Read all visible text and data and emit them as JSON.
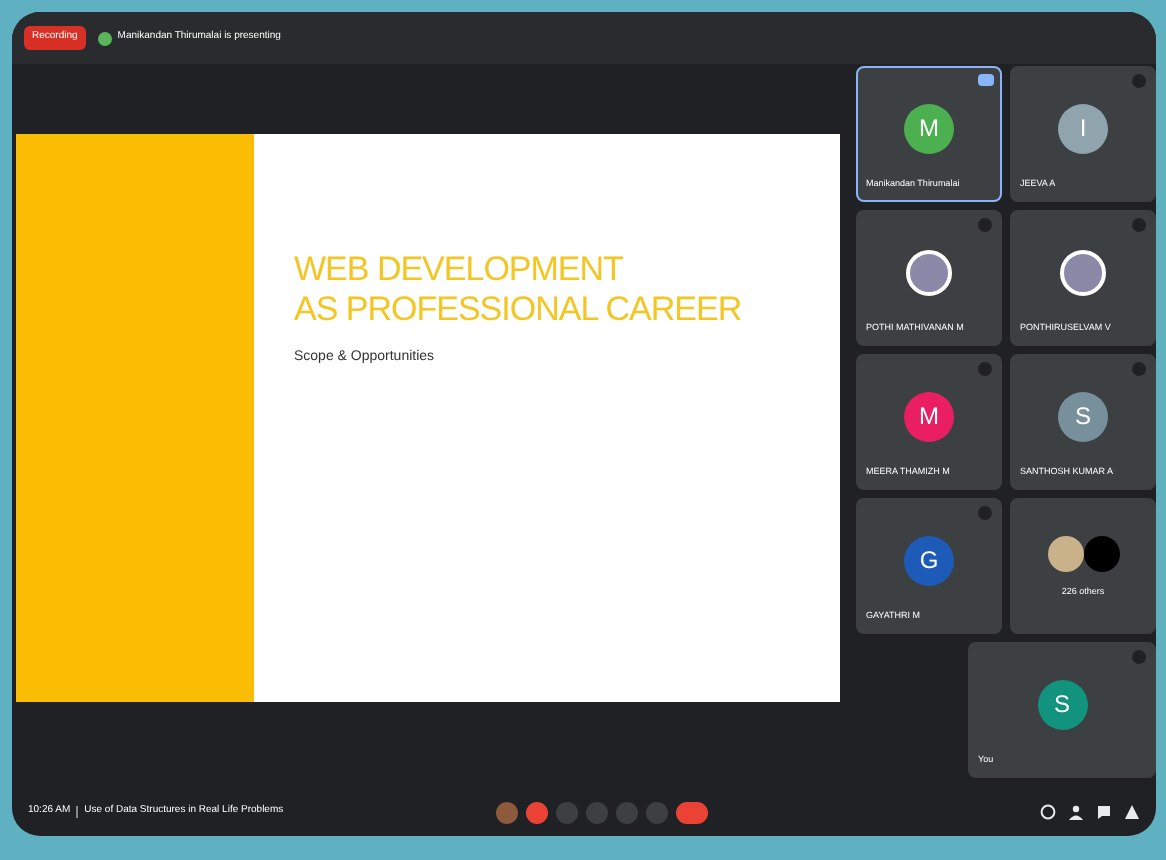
{
  "top_bar": {
    "recording": "Recording",
    "presenter": "Manikandan Thirumalai is presenting"
  },
  "slide": {
    "title_lines": [
      "WEB DEVELOPMENT",
      "AS PROFESSIONAL CAREER"
    ],
    "subtitle": "Scope & Opportunities"
  },
  "participants": [
    {
      "name": "Manikandan Thirumalai",
      "kind": "letter",
      "initial": "M",
      "color": "#4caf50",
      "speaking": true
    },
    {
      "name": "JEEVA A",
      "kind": "letter",
      "initial": "I",
      "color": "#90a4ae",
      "speaking": false
    },
    {
      "name": "POTHI MATHIVANAN M",
      "kind": "photo",
      "speaking": false
    },
    {
      "name": "PONTHIRUSELVAM V",
      "kind": "photo",
      "speaking": false
    },
    {
      "name": "MEERA THAMIZH M",
      "kind": "letter",
      "initial": "M",
      "color": "#e91e63",
      "speaking": false
    },
    {
      "name": "SANTHOSH KUMAR A",
      "kind": "letter",
      "initial": "S",
      "color": "#78909c",
      "speaking": false
    },
    {
      "name": "GAYATHRI M",
      "kind": "letter",
      "initial": "G",
      "color": "#1e5bb8",
      "speaking": false
    },
    {
      "name": "226 others",
      "kind": "group",
      "speaking": false
    }
  ],
  "self_tile": {
    "name": "You",
    "initial": "S",
    "color": "#12937e"
  },
  "bottom_bar": {
    "time": "10:26 AM",
    "meeting": "Use of Data Structures in Real Life Problems",
    "controls": [
      {
        "kind": "avatar",
        "danger": false
      },
      {
        "kind": "mic",
        "danger": true
      },
      {
        "kind": "captions",
        "danger": false
      },
      {
        "kind": "hand",
        "danger": false
      },
      {
        "kind": "present",
        "danger": false
      },
      {
        "kind": "more",
        "danger": false
      },
      {
        "kind": "hangup",
        "danger": true
      }
    ]
  }
}
